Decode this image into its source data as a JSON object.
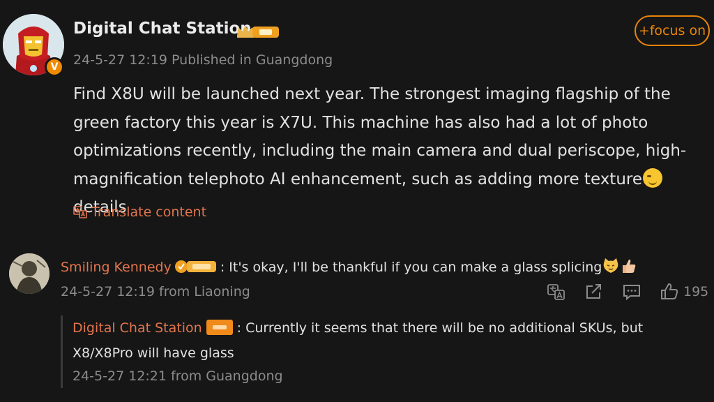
{
  "post": {
    "author": "Digital Chat Station",
    "timestamp": "24-5-27 12:19",
    "location": "Published in Guangdong",
    "follow_label": "+focus on",
    "text_before_emoji": "Find X8U will be launched next year. The strongest imaging flagship of the green factory this year is X7U. This machine has also had a lot of photo optimizations recently, including the main camera and dual periscope, high-magnification telephoto AI enhancement, such as adding more texture",
    "text_after_emoji": "details",
    "translate_label": "Translate content",
    "verified_mark": "V",
    "author_badge_icon": "crown-vip-badge"
  },
  "comment": {
    "author": "Smiling Kennedy",
    "separator": ":",
    "text": " It's okay, I'll be thankful if you can make a glass splicing",
    "timestamp": "24-5-27 12:19",
    "location": "from Liaoning",
    "like_count": "195"
  },
  "reply": {
    "author": "Digital Chat Station",
    "separator": ":",
    "text": " Currently it seems that there will be no additional SKUs, but X8/X8Pro will have glass",
    "timestamp": "24-5-27 12:21",
    "location": "from Guangdong"
  },
  "colors": {
    "background": "#161616",
    "accent_orange": "#e8840a",
    "name_orange": "#e2764e",
    "meta_gray": "#8c8c8c"
  }
}
